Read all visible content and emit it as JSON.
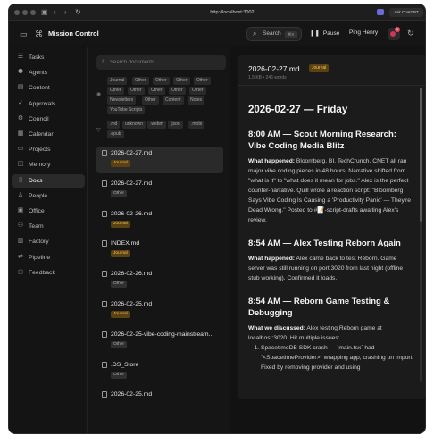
{
  "browser": {
    "url": "http://localhost:3002",
    "ask_button": "Ask ChatGPT"
  },
  "header": {
    "app_title": "Mission Control",
    "search_label": "Search",
    "search_shortcut": "⌘K",
    "pause_label": "Pause",
    "ping_label": "Ping Henry",
    "notification_count": "1"
  },
  "sidebar": {
    "items": [
      {
        "label": "Tasks",
        "icon": "list-icon",
        "glyph": "☰"
      },
      {
        "label": "Agents",
        "icon": "agents-icon",
        "glyph": "⚉"
      },
      {
        "label": "Content",
        "icon": "content-icon",
        "glyph": "▤"
      },
      {
        "label": "Approvals",
        "icon": "approvals-icon",
        "glyph": "✓"
      },
      {
        "label": "Council",
        "icon": "council-icon",
        "glyph": "⚙"
      },
      {
        "label": "Calendar",
        "icon": "calendar-icon",
        "glyph": "▦"
      },
      {
        "label": "Projects",
        "icon": "projects-icon",
        "glyph": "▭"
      },
      {
        "label": "Memory",
        "icon": "memory-icon",
        "glyph": "◫"
      },
      {
        "label": "Docs",
        "icon": "docs-icon",
        "glyph": "▯"
      },
      {
        "label": "People",
        "icon": "people-icon",
        "glyph": "♙"
      },
      {
        "label": "Office",
        "icon": "office-icon",
        "glyph": "▣"
      },
      {
        "label": "Team",
        "icon": "team-icon",
        "glyph": "⚇"
      },
      {
        "label": "Factory",
        "icon": "factory-icon",
        "glyph": "▥"
      },
      {
        "label": "Pipeline",
        "icon": "pipeline-icon",
        "glyph": "⇄"
      },
      {
        "label": "Feedback",
        "icon": "feedback-icon",
        "glyph": "◻"
      }
    ],
    "active": "Docs"
  },
  "docs": {
    "search_placeholder": "Search documents...",
    "category_chips": [
      "Journal",
      "Other",
      "Other",
      "Other",
      "Other",
      "Other",
      "Other",
      "Other",
      "Other",
      "Other",
      "Newsletters",
      "Other",
      "Content",
      "Notes",
      "YouTube Scripts"
    ],
    "type_chips": [
      ".md",
      "unknown",
      ".webm",
      ".json",
      ".mobi",
      ".epub"
    ],
    "files": [
      {
        "name": "2026-02-27.md",
        "tag": "Journal"
      },
      {
        "name": "2026-02-27.md",
        "tag": "Other"
      },
      {
        "name": "2026-02-26.md",
        "tag": "Journal"
      },
      {
        "name": "INDEX.md",
        "tag": "Journal"
      },
      {
        "name": "2026-02-26.md",
        "tag": "Other"
      },
      {
        "name": "2026-02-25.md",
        "tag": "Journal"
      },
      {
        "name": "2026-02-25-vibe-coding-mainstream...",
        "tag": "Other"
      },
      {
        "name": ".DS_Store",
        "tag": "Other"
      },
      {
        "name": "2026-02-25.md",
        "tag": ""
      }
    ]
  },
  "document": {
    "filename": "2026-02-27.md",
    "tag": "Journal",
    "meta": "1.5 KB • 246 words",
    "title": "2026-02-27 — Friday",
    "s1_heading": "8:00 AM — Scout Morning Research: Vibe Coding Media Blitz",
    "s1_label": "What happened:",
    "s1_text": " Bloomberg, BI, TechCrunch, CNET all ran major vibe coding pieces in 48 hours. Narrative shifted from \"what is it\" to \"what does it mean for jobs.\" Alex is the perfect counter-narrative. Quill wrote a reaction script: \"Bloomberg Says Vibe Coding Is Causing a 'Productivity Panic' — They're Dead Wrong.\" Posted to #📝-script-drafts awaiting Alex's review.",
    "s2_heading": "8:54 AM — Alex Testing Reborn Again",
    "s2_label": "What happened:",
    "s2_text": " Alex came back to test Reborn. Game server was still running on port 3020 from last night (offline stub working). Confirmed it loads.",
    "s3_heading": "8:54 AM — Reborn Game Testing & Debugging",
    "s3_label": "What we discussed:",
    "s3_text": " Alex testing Reborn game at localhost:3020. Hit multiple issues:",
    "s3_item1": "SpacetimeDB SDK crash — `main.tsx` had `<SpacetimeProvider>` wrapping app, crashing on import. Fixed by removing provider and using"
  }
}
